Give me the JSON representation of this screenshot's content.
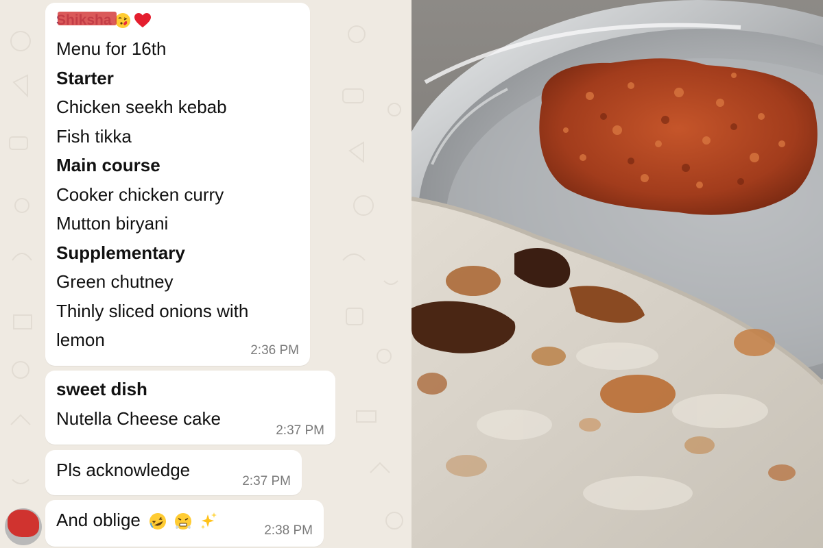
{
  "chat": {
    "sender": "Shiksha",
    "messages": [
      {
        "lines": [
          {
            "text": "Menu for 16th",
            "bold": false
          },
          {
            "text": "Starter",
            "bold": true
          },
          {
            "text": "Chicken seekh kebab",
            "bold": false
          },
          {
            "text": "Fish tikka",
            "bold": false
          },
          {
            "text": "Main course",
            "bold": true
          },
          {
            "text": "Cooker chicken curry",
            "bold": false
          },
          {
            "text": "Mutton biryani",
            "bold": false
          },
          {
            "text": "Supplementary",
            "bold": true
          },
          {
            "text": "Green chutney",
            "bold": false
          },
          {
            "text": "Thinly sliced onions with",
            "bold": false
          },
          {
            "text": "lemon",
            "bold": false
          }
        ],
        "time": "2:36 PM"
      },
      {
        "lines": [
          {
            "text": "sweet dish",
            "bold": true
          },
          {
            "text": "Nutella Cheese cake",
            "bold": false
          }
        ],
        "time": "2:37 PM"
      },
      {
        "lines": [
          {
            "text": "Pls acknowledge",
            "bold": false
          }
        ],
        "time": "2:37 PM"
      },
      {
        "lines": [
          {
            "text": "And oblige",
            "bold": false
          }
        ],
        "time": "2:38 PM"
      }
    ]
  },
  "icons": {
    "sender_emojis": [
      "face-blowing-kiss-icon",
      "red-heart-icon"
    ],
    "oblige_emojis": [
      "rolling-laughing-icon",
      "steam-from-nose-icon",
      "sparkles-icon"
    ]
  },
  "colors": {
    "chat_background": "#efeae2",
    "bubble": "#ffffff",
    "sender_name": "#6b3c7a",
    "timestamp": "#7a7a7a"
  }
}
